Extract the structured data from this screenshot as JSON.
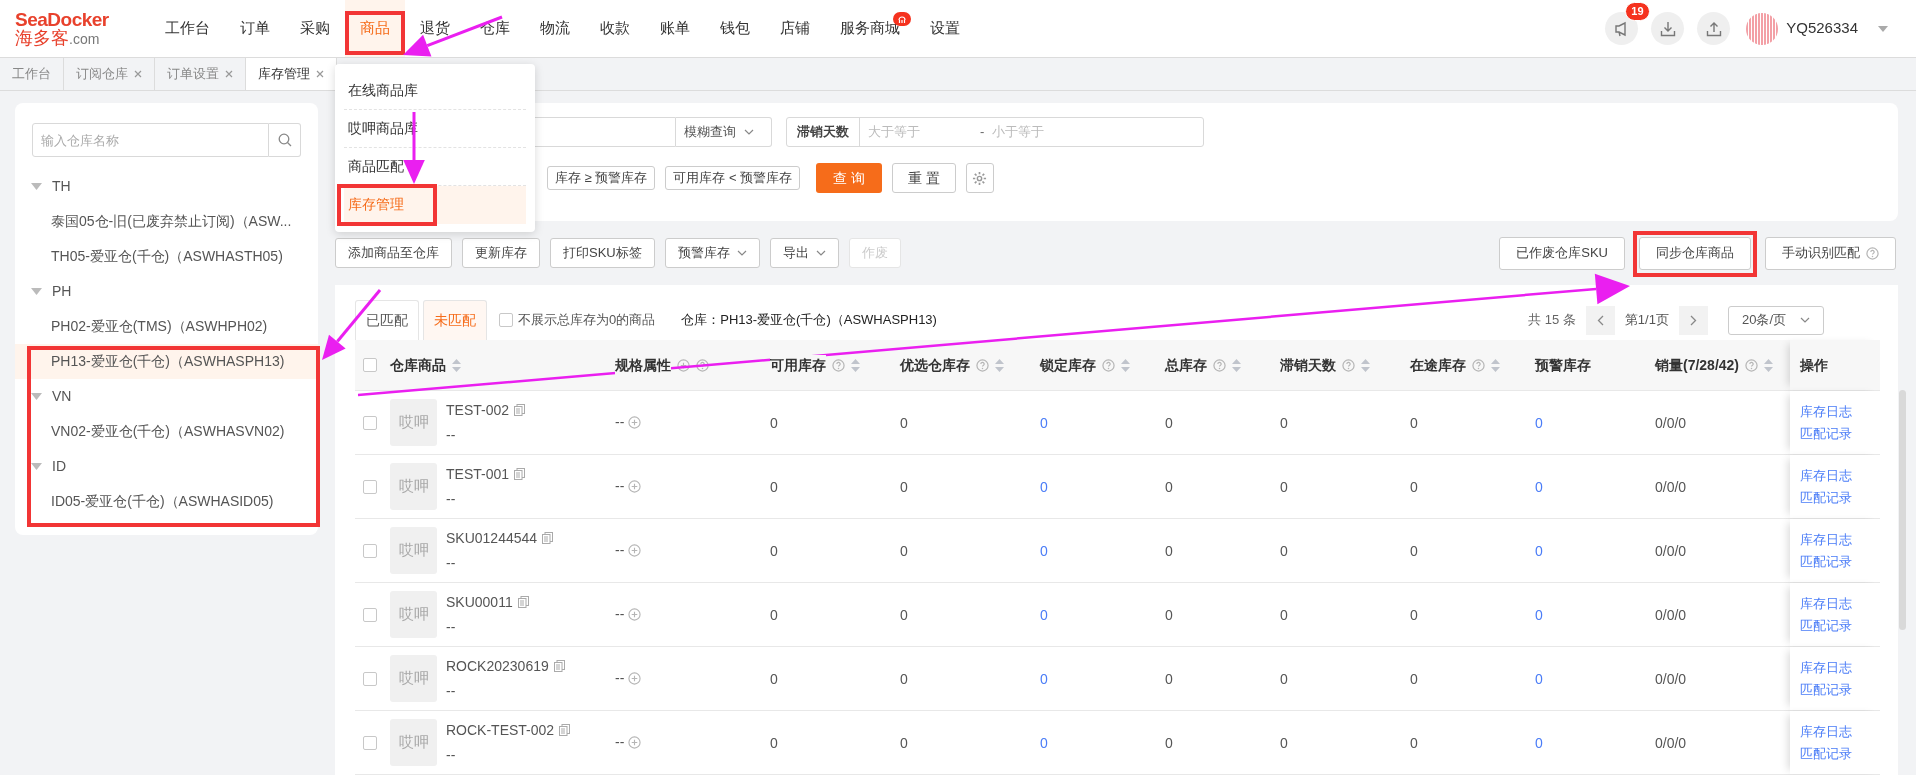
{
  "logo": {
    "name": "SeaDocker",
    "cn": "海多客",
    "domain": ".com"
  },
  "nav": [
    {
      "label": "工作台",
      "selected": false,
      "badge": false
    },
    {
      "label": "订单",
      "selected": false,
      "badge": false
    },
    {
      "label": "采购",
      "selected": false,
      "badge": false
    },
    {
      "label": "商品",
      "selected": true,
      "badge": false
    },
    {
      "label": "退货",
      "selected": false,
      "badge": false
    },
    {
      "label": "仓库",
      "selected": false,
      "badge": false
    },
    {
      "label": "物流",
      "selected": false,
      "badge": false
    },
    {
      "label": "收款",
      "selected": false,
      "badge": false
    },
    {
      "label": "账单",
      "selected": false,
      "badge": false
    },
    {
      "label": "钱包",
      "selected": false,
      "badge": false
    },
    {
      "label": "店铺",
      "selected": false,
      "badge": false
    },
    {
      "label": "服务商城",
      "selected": false,
      "badge": true
    },
    {
      "label": "设置",
      "selected": false,
      "badge": false
    }
  ],
  "notifications": {
    "count": "19"
  },
  "user": {
    "name": "YQ526334"
  },
  "tabs": [
    {
      "label": "工作台",
      "closable": false,
      "selected": false
    },
    {
      "label": "订阅仓库",
      "closable": true,
      "selected": false
    },
    {
      "label": "订单设置",
      "closable": true,
      "selected": false
    },
    {
      "label": "库存管理",
      "closable": true,
      "selected": true
    }
  ],
  "menu": [
    {
      "label": "在线商品库",
      "selected": false
    },
    {
      "label": "哎呷商品库",
      "selected": false
    },
    {
      "label": "商品匹配",
      "selected": false
    },
    {
      "label": "库存管理",
      "selected": true
    }
  ],
  "sidebar": {
    "search": {
      "placeholder": "输入仓库名称"
    },
    "groups": [
      {
        "label": "TH",
        "expanded": true,
        "children": [
          {
            "label": "泰国05仓-旧(已废弃禁止订阅)（ASW...",
            "selected": false
          },
          {
            "label": "TH05-爱亚仓(千仓)（ASWHASTH05)",
            "selected": false
          }
        ]
      },
      {
        "label": "PH",
        "expanded": true,
        "children": [
          {
            "label": "PH02-爱亚仓(TMS)（ASWHPH02)",
            "selected": false
          },
          {
            "label": "PH13-爱亚仓(千仓)（ASWHASPH13)",
            "selected": true
          }
        ]
      },
      {
        "label": "VN",
        "expanded": true,
        "children": [
          {
            "label": "VN02-爱亚仓(千仓)（ASWHASVN02)",
            "selected": false
          }
        ]
      },
      {
        "label": "ID",
        "expanded": true,
        "children": [
          {
            "label": "ID05-爱亚仓(千仓)（ASWHASID05)",
            "selected": false
          }
        ]
      }
    ]
  },
  "filters": {
    "match_mode": "模糊查询",
    "range": {
      "label": "滞销天数",
      "min_placeholder": "大于等于",
      "separator": "-",
      "max_placeholder": "小于等于"
    },
    "quick": [
      "库存 ≥ 预警库存",
      "可用库存 < 预警库存"
    ],
    "search_button": "查 询",
    "reset_button": "重 置"
  },
  "toolbar": {
    "left": [
      {
        "label": "添加商品至仓库",
        "caret": false,
        "disabled": false
      },
      {
        "label": "更新库存",
        "caret": false,
        "disabled": false
      },
      {
        "label": "打印SKU标签",
        "caret": false,
        "disabled": false
      },
      {
        "label": "预警库存",
        "caret": true,
        "disabled": false
      },
      {
        "label": "导出",
        "caret": true,
        "disabled": false
      },
      {
        "label": "作废",
        "caret": false,
        "disabled": true
      }
    ],
    "right": [
      {
        "label": "已作废仓库SKU",
        "help": false
      },
      {
        "label": "同步仓库商品",
        "help": false
      },
      {
        "label": "手动识别匹配",
        "help": true
      }
    ]
  },
  "match_tabs": [
    {
      "label": "已匹配",
      "selected": false
    },
    {
      "label": "未匹配",
      "selected": true
    }
  ],
  "hide_zero": {
    "label": "不展示总库存为0的商品",
    "checked": false
  },
  "warehouse": "仓库：PH13-爱亚仓(千仓)（ASWHASPH13)",
  "pagination": {
    "total": "共 15 条",
    "page": "第1/1页",
    "page_size": "20条/页"
  },
  "table": {
    "select_all": {
      "checked": false
    },
    "columns": [
      {
        "label": "仓库商品",
        "kind": "product",
        "help": false,
        "sort": true
      },
      {
        "label": "规格属性",
        "kind": "spec",
        "help": true,
        "sort": false
      },
      {
        "label": "可用库存",
        "kind": "text",
        "help": true,
        "sort": true
      },
      {
        "label": "优选仓库存",
        "kind": "text",
        "help": true,
        "sort": true
      },
      {
        "label": "锁定库存",
        "kind": "link",
        "help": true,
        "sort": true
      },
      {
        "label": "总库存",
        "kind": "text",
        "help": true,
        "sort": true
      },
      {
        "label": "滞销天数",
        "kind": "text",
        "help": true,
        "sort": true
      },
      {
        "label": "在途库存",
        "kind": "text",
        "help": true,
        "sort": true
      },
      {
        "label": "预警库存",
        "kind": "link",
        "help": false,
        "sort": false
      },
      {
        "label": "销量(7/28/42)",
        "kind": "text",
        "help": true,
        "sort": true
      },
      {
        "label": "操作",
        "kind": "actions",
        "help": false,
        "sort": false
      }
    ],
    "rows": [
      {
        "checked": false,
        "cells": [
          {
            "thumb": "哎呷",
            "sku": "TEST-002",
            "variant": "--"
          },
          "--",
          "0",
          "0",
          "0",
          "0",
          "0",
          "0",
          "0",
          "0/0/0",
          [
            "库存日志",
            "匹配记录"
          ]
        ]
      },
      {
        "checked": false,
        "cells": [
          {
            "thumb": "哎呷",
            "sku": "TEST-001",
            "variant": "--"
          },
          "--",
          "0",
          "0",
          "0",
          "0",
          "0",
          "0",
          "0",
          "0/0/0",
          [
            "库存日志",
            "匹配记录"
          ]
        ]
      },
      {
        "checked": false,
        "cells": [
          {
            "thumb": "哎呷",
            "sku": "SKU01244544",
            "variant": "--"
          },
          "--",
          "0",
          "0",
          "0",
          "0",
          "0",
          "0",
          "0",
          "0/0/0",
          [
            "库存日志",
            "匹配记录"
          ]
        ]
      },
      {
        "checked": false,
        "cells": [
          {
            "thumb": "哎呷",
            "sku": "SKU00011",
            "variant": "--"
          },
          "--",
          "0",
          "0",
          "0",
          "0",
          "0",
          "0",
          "0",
          "0/0/0",
          [
            "库存日志",
            "匹配记录"
          ]
        ]
      },
      {
        "checked": false,
        "cells": [
          {
            "thumb": "哎呷",
            "sku": "ROCK20230619",
            "variant": "--"
          },
          "--",
          "0",
          "0",
          "0",
          "0",
          "0",
          "0",
          "0",
          "0/0/0",
          [
            "库存日志",
            "匹配记录"
          ]
        ]
      },
      {
        "checked": false,
        "cells": [
          {
            "thumb": "哎呷",
            "sku": "ROCK-TEST-002",
            "variant": "--"
          },
          "--",
          "0",
          "0",
          "0",
          "0",
          "0",
          "0",
          "0",
          "0/0/0",
          [
            "库存日志",
            "匹配记录"
          ]
        ]
      }
    ]
  }
}
